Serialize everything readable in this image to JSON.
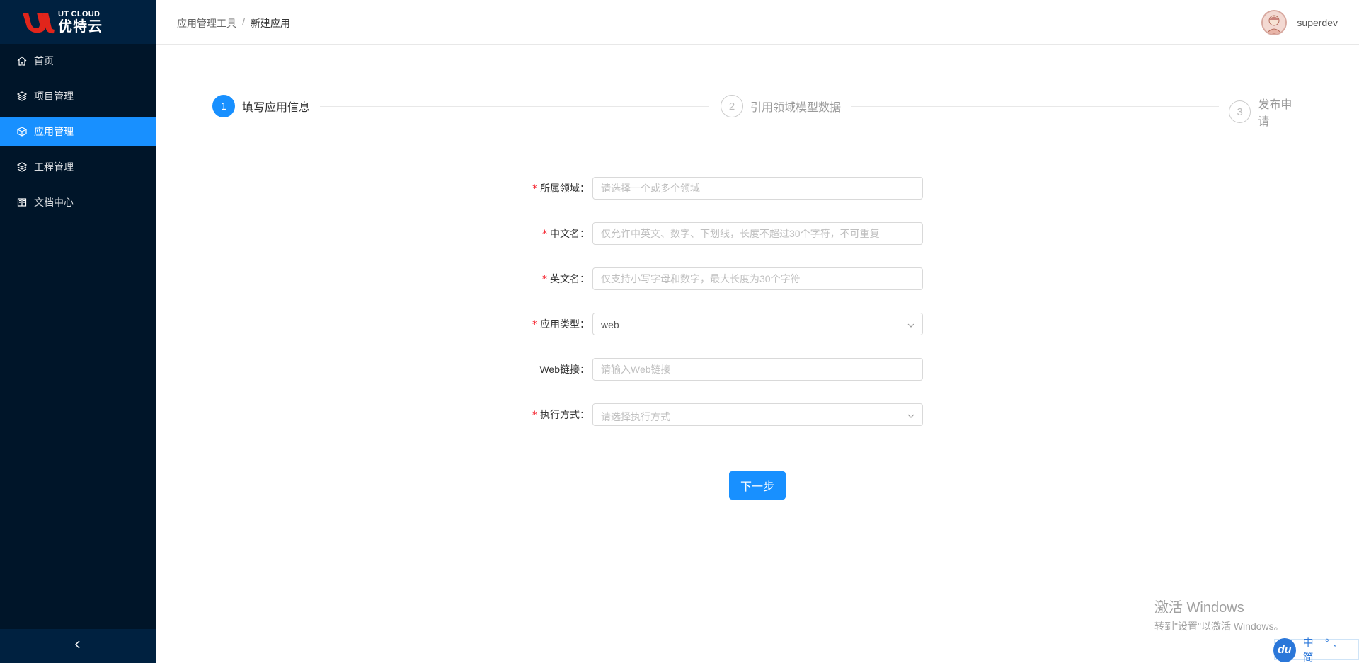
{
  "brand": {
    "en": "UT CLOUD",
    "cn": "优特云"
  },
  "sidebar": {
    "items": [
      {
        "label": "首页",
        "icon": "home-icon",
        "active": false
      },
      {
        "label": "项目管理",
        "icon": "layers-icon",
        "active": false
      },
      {
        "label": "应用管理",
        "icon": "cube-icon",
        "active": true
      },
      {
        "label": "工程管理",
        "icon": "layers-icon",
        "active": false
      },
      {
        "label": "文档中心",
        "icon": "book-icon",
        "active": false
      }
    ],
    "collapse_icon": "chevron-left-icon"
  },
  "header": {
    "breadcrumb": [
      "应用管理工具",
      "新建应用"
    ],
    "separator": "/",
    "username": "superdev"
  },
  "steps": [
    {
      "number": "1",
      "title": "填写应用信息",
      "status": "active"
    },
    {
      "number": "2",
      "title": "引用领域模型数据",
      "status": "wait"
    },
    {
      "number": "3",
      "title": "发布申请",
      "status": "wait"
    }
  ],
  "form": {
    "domain": {
      "label": "所属领域",
      "required": true,
      "placeholder": "请选择一个或多个领域",
      "value": ""
    },
    "cn_name": {
      "label": "中文名",
      "required": true,
      "placeholder": "仅允许中英文、数字、下划线，长度不超过30个字符，不可重复",
      "value": ""
    },
    "en_name": {
      "label": "英文名",
      "required": true,
      "placeholder": "仅支持小写字母和数字，最大长度为30个字符",
      "value": ""
    },
    "app_type": {
      "label": "应用类型",
      "required": true,
      "value": "web"
    },
    "web_link": {
      "label": "Web链接",
      "required": false,
      "placeholder": "请输入Web链接",
      "value": ""
    },
    "exec_mode": {
      "label": "执行方式",
      "required": true,
      "placeholder": "请选择执行方式",
      "value": ""
    },
    "colon": "："
  },
  "next_button": "下一步",
  "watermark": {
    "line1": "激活 Windows",
    "line2": "转到\"设置\"以激活 Windows。"
  },
  "ime": {
    "logo": "du",
    "text": "中 °, 简"
  },
  "colors": {
    "primary": "#1890ff",
    "sidebar_bg": "#001529",
    "required": "#f5222d"
  }
}
